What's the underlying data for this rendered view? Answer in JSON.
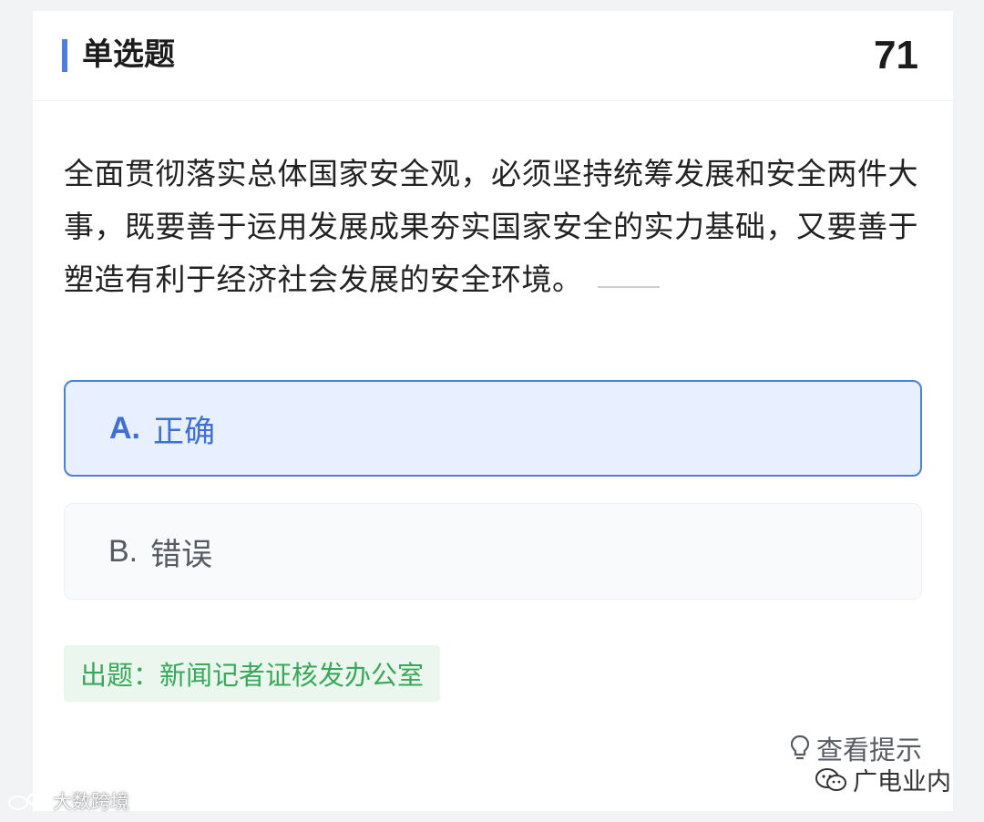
{
  "header": {
    "question_type": "单选题",
    "question_number": "71"
  },
  "question": {
    "text": "全面贯彻落实总体国家安全观，必须坚持统筹发展和安全两件大事，既要善于运用发展成果夯实国家安全的实力基础，又要善于塑造有利于经济社会发展的安全环境。"
  },
  "options": [
    {
      "letter": "A.",
      "label": "正确",
      "selected": true
    },
    {
      "letter": "B.",
      "label": "错误",
      "selected": false
    }
  ],
  "source": {
    "text": "出题：新闻记者证核发办公室"
  },
  "hint": {
    "label": "查看提示",
    "icon": "lightbulb-icon"
  },
  "watermarks": {
    "right": "广电业内",
    "left": "大数跨境"
  },
  "colors": {
    "accent": "#4a7fdc",
    "selected_bg": "#e8f0ff",
    "source_green": "#3aa85a"
  }
}
